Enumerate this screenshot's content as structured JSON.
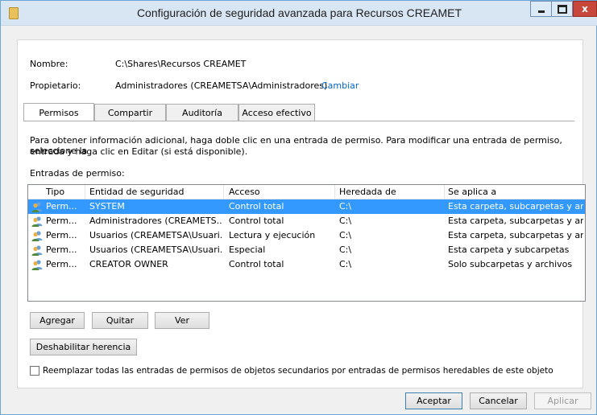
{
  "window": {
    "title": "Configuración de seguridad avanzada para Recursos CREAMET",
    "close_glyph": "x"
  },
  "info": {
    "name_label": "Nombre:",
    "name_value": "C:\\Shares\\Recursos CREAMET",
    "owner_label": "Propietario:",
    "owner_value": "Administradores (CREAMETSA\\Administradores)",
    "change_link": "Cambiar"
  },
  "tabs": [
    {
      "label": "Permisos",
      "active": true
    },
    {
      "label": "Compartir",
      "active": false
    },
    {
      "label": "Auditoría",
      "active": false
    },
    {
      "label": "Acceso efectivo",
      "active": false
    }
  ],
  "description_line1": "Para obtener información adicional, haga doble clic en una entrada de permiso. Para modificar una entrada de permiso, seleccione la",
  "description_line2": "entrada y haga clic en Editar (si está disponible).",
  "entries_label": "Entradas de permiso:",
  "table": {
    "headers": [
      "Tipo",
      "Entidad de seguridad",
      "Acceso",
      "Heredada de",
      "Se aplica a"
    ],
    "rows": [
      {
        "type": "Perm...",
        "principal": "SYSTEM",
        "access": "Control total",
        "inherited": "C:\\",
        "applies": "Esta carpeta, subcarpetas y arc...",
        "selected": true
      },
      {
        "type": "Perm...",
        "principal": "Administradores (CREAMETS...",
        "access": "Control total",
        "inherited": "C:\\",
        "applies": "Esta carpeta, subcarpetas y arc...",
        "selected": false
      },
      {
        "type": "Perm...",
        "principal": "Usuarios (CREAMETSA\\Usuari...",
        "access": "Lectura y ejecución",
        "inherited": "C:\\",
        "applies": "Esta carpeta, subcarpetas y arc...",
        "selected": false
      },
      {
        "type": "Perm...",
        "principal": "Usuarios (CREAMETSA\\Usuari...",
        "access": "Especial",
        "inherited": "C:\\",
        "applies": "Esta carpeta y subcarpetas",
        "selected": false
      },
      {
        "type": "Perm...",
        "principal": "CREATOR OWNER",
        "access": "Control total",
        "inherited": "C:\\",
        "applies": "Solo subcarpetas y archivos",
        "selected": false
      }
    ]
  },
  "buttons": {
    "add": "Agregar",
    "remove": "Quitar",
    "view": "Ver",
    "disable_inheritance": "Deshabilitar herencia",
    "ok": "Aceptar",
    "cancel": "Cancelar",
    "apply": "Aplicar"
  },
  "replace_checkbox": {
    "label": "Reemplazar todas las entradas de permisos de objetos secundarios por entradas de permisos heredables de este objeto",
    "checked": false
  }
}
